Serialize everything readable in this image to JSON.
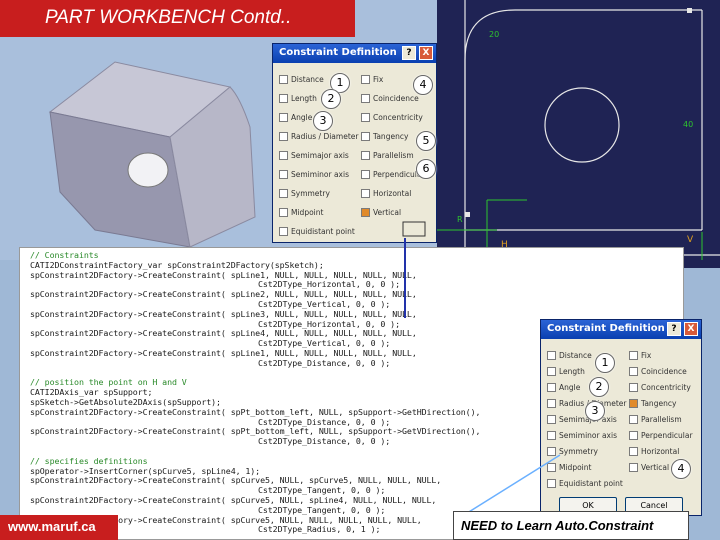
{
  "slide": {
    "title": "PART WORKBENCH Contd..",
    "footer_left": "www.maruf.ca",
    "footer_right": "NEED to Learn Auto.Constraint"
  },
  "dialog_top": {
    "title": "Constraint Definition",
    "help_btn": "?",
    "close_btn": "X",
    "left_items": [
      {
        "label": "Distance",
        "checked": false
      },
      {
        "label": "Length",
        "checked": false
      },
      {
        "label": "Angle",
        "checked": false
      },
      {
        "label": "Radius / Diameter",
        "checked": false
      },
      {
        "label": "Semimajor axis",
        "checked": false
      },
      {
        "label": "Semiminor axis",
        "checked": false
      },
      {
        "label": "Symmetry",
        "checked": false
      },
      {
        "label": "Midpoint",
        "checked": false
      },
      {
        "label": "Equidistant point",
        "checked": false
      }
    ],
    "right_items": [
      {
        "label": "Fix",
        "checked": false
      },
      {
        "label": "Coincidence",
        "checked": false
      },
      {
        "label": "Concentricity",
        "checked": false
      },
      {
        "label": "Tangency",
        "checked": false
      },
      {
        "label": "Parallelism",
        "checked": false
      },
      {
        "label": "Perpendicular",
        "checked": false
      },
      {
        "label": "Horizontal",
        "checked": false
      },
      {
        "label": "Vertical",
        "checked": true
      }
    ],
    "callouts": [
      "1",
      "2",
      "3",
      "4",
      "5",
      "6"
    ]
  },
  "dialog_bottom": {
    "title": "Constraint Definition",
    "help_btn": "?",
    "close_btn": "X",
    "ok_label": "OK",
    "cancel_label": "Cancel",
    "left_items": [
      {
        "label": "Distance",
        "checked": false
      },
      {
        "label": "Length",
        "checked": false
      },
      {
        "label": "Angle",
        "checked": false
      },
      {
        "label": "Radius / Diameter",
        "checked": false
      },
      {
        "label": "Semimajor axis",
        "checked": false
      },
      {
        "label": "Semiminor axis",
        "checked": false
      },
      {
        "label": "Symmetry",
        "checked": false
      },
      {
        "label": "Midpoint",
        "checked": false
      },
      {
        "label": "Equidistant point",
        "checked": false
      }
    ],
    "right_items": [
      {
        "label": "Fix",
        "checked": false
      },
      {
        "label": "Coincidence",
        "checked": false
      },
      {
        "label": "Concentricity",
        "checked": false
      },
      {
        "label": "Tangency",
        "checked": true
      },
      {
        "label": "Parallelism",
        "checked": false
      },
      {
        "label": "Perpendicular",
        "checked": false
      },
      {
        "label": "Horizontal",
        "checked": false
      },
      {
        "label": "Vertical",
        "checked": false
      }
    ],
    "callouts": [
      "1",
      "2",
      "3",
      "4"
    ]
  },
  "sketch": {
    "dims": [
      "20",
      "40",
      "R"
    ],
    "icons": [
      "H",
      "V"
    ]
  },
  "code_lines": [
    {
      "text": "// Constraints",
      "type": "comment"
    },
    {
      "text": "CATI2DConstraintFactory_var spConstraint2DFactory(spSketch);",
      "type": "code"
    },
    {
      "text": "spConstraint2DFactory->CreateConstraint( spLine1, NULL, NULL, NULL, NULL, NULL,",
      "type": "code"
    },
    {
      "text": "Cst2DType_Horizontal, 0, 0 );",
      "type": "sub"
    },
    {
      "text": "spConstraint2DFactory->CreateConstraint( spLine2, NULL, NULL, NULL, NULL, NULL,",
      "type": "code"
    },
    {
      "text": "Cst2DType_Vertical, 0, 0 );",
      "type": "sub"
    },
    {
      "text": "spConstraint2DFactory->CreateConstraint( spLine3, NULL, NULL, NULL, NULL, NULL,",
      "type": "code"
    },
    {
      "text": "Cst2DType_Horizontal, 0, 0 );",
      "type": "sub"
    },
    {
      "text": "spConstraint2DFactory->CreateConstraint( spLine4, NULL, NULL, NULL, NULL, NULL,",
      "type": "code"
    },
    {
      "text": "Cst2DType_Vertical, 0, 0 );",
      "type": "sub"
    },
    {
      "text": "spConstraint2DFactory->CreateConstraint( spLine1, NULL, NULL, NULL, NULL, NULL,",
      "type": "code"
    },
    {
      "text": "Cst2DType_Distance, 0, 0 );",
      "type": "sub"
    },
    {
      "text": "",
      "type": "code"
    },
    {
      "text": "// position the point on H and V",
      "type": "comment"
    },
    {
      "text": "CATI2DAxis_var spSupport;",
      "type": "code"
    },
    {
      "text": "spSketch->GetAbsolute2DAxis(spSupport);",
      "type": "code"
    },
    {
      "text": "spConstraint2DFactory->CreateConstraint( spPt_bottom_left, NULL, spSupport->GetHDirection(),",
      "type": "code"
    },
    {
      "text": "Cst2DType_Distance, 0, 0 );",
      "type": "sub"
    },
    {
      "text": "spConstraint2DFactory->CreateConstraint( spPt_bottom_left, NULL, spSupport->GetVDirection(),",
      "type": "code"
    },
    {
      "text": "Cst2DType_Distance, 0, 0 );",
      "type": "sub"
    },
    {
      "text": "",
      "type": "code"
    },
    {
      "text": "// specifies definitions",
      "type": "comment"
    },
    {
      "text": "spOperator->InsertCorner(spCurve5, spLine4, 1);",
      "type": "code"
    },
    {
      "text": "spConstraint2DFactory->CreateConstraint( spCurve5, NULL, spCurve5, NULL, NULL, NULL,",
      "type": "code"
    },
    {
      "text": "Cst2DType_Tangent, 0, 0 );",
      "type": "sub"
    },
    {
      "text": "spConstraint2DFactory->CreateConstraint( spCurve5, NULL, spLine4, NULL, NULL, NULL,",
      "type": "code"
    },
    {
      "text": "Cst2DType_Tangent, 0, 0 );",
      "type": "sub"
    },
    {
      "text": "spConstraint2DFactory->CreateConstraint( spCurve5, NULL, NULL, NULL, NULL, NULL,",
      "type": "code"
    },
    {
      "text": "Cst2DType_Radius, 0, 1 );",
      "type": "sub"
    }
  ]
}
